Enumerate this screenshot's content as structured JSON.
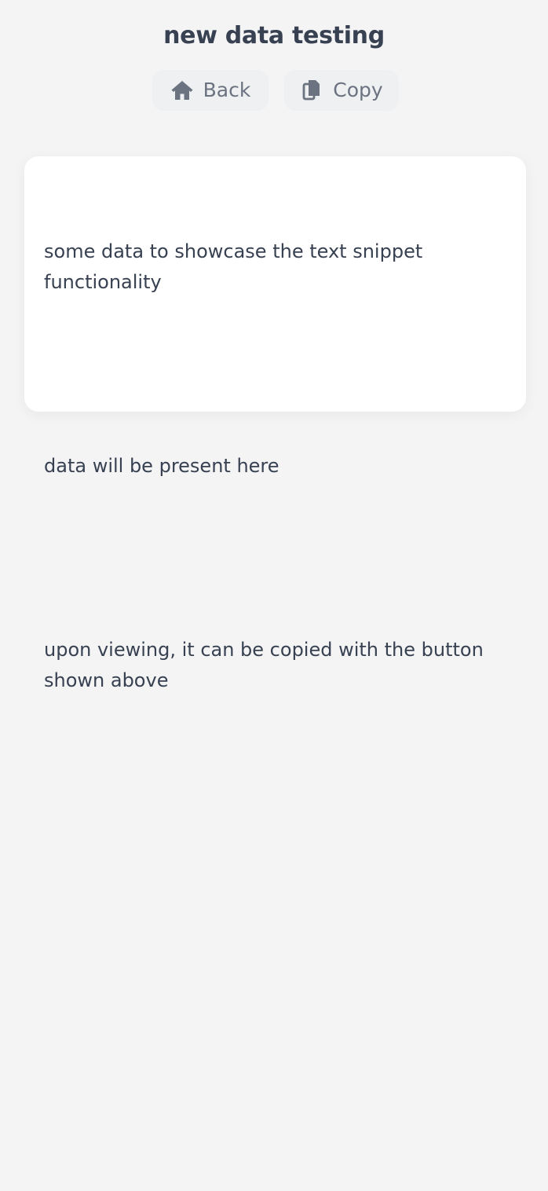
{
  "page": {
    "title": "new data testing"
  },
  "toolbar": {
    "back": {
      "label": "Back",
      "icon": "home-icon"
    },
    "copy": {
      "label": "Copy",
      "icon": "copy-icon"
    }
  },
  "snippet": {
    "lines": [
      "some data to showcase the text snippet functionality",
      "",
      "data will be present here",
      "",
      "upon viewing, it can be copied with the button shown above"
    ]
  },
  "colors": {
    "background": "#f4f4f5",
    "card": "#ffffff",
    "text": "#374151",
    "button_bg": "#eef0f2",
    "button_text": "#6b7280"
  }
}
